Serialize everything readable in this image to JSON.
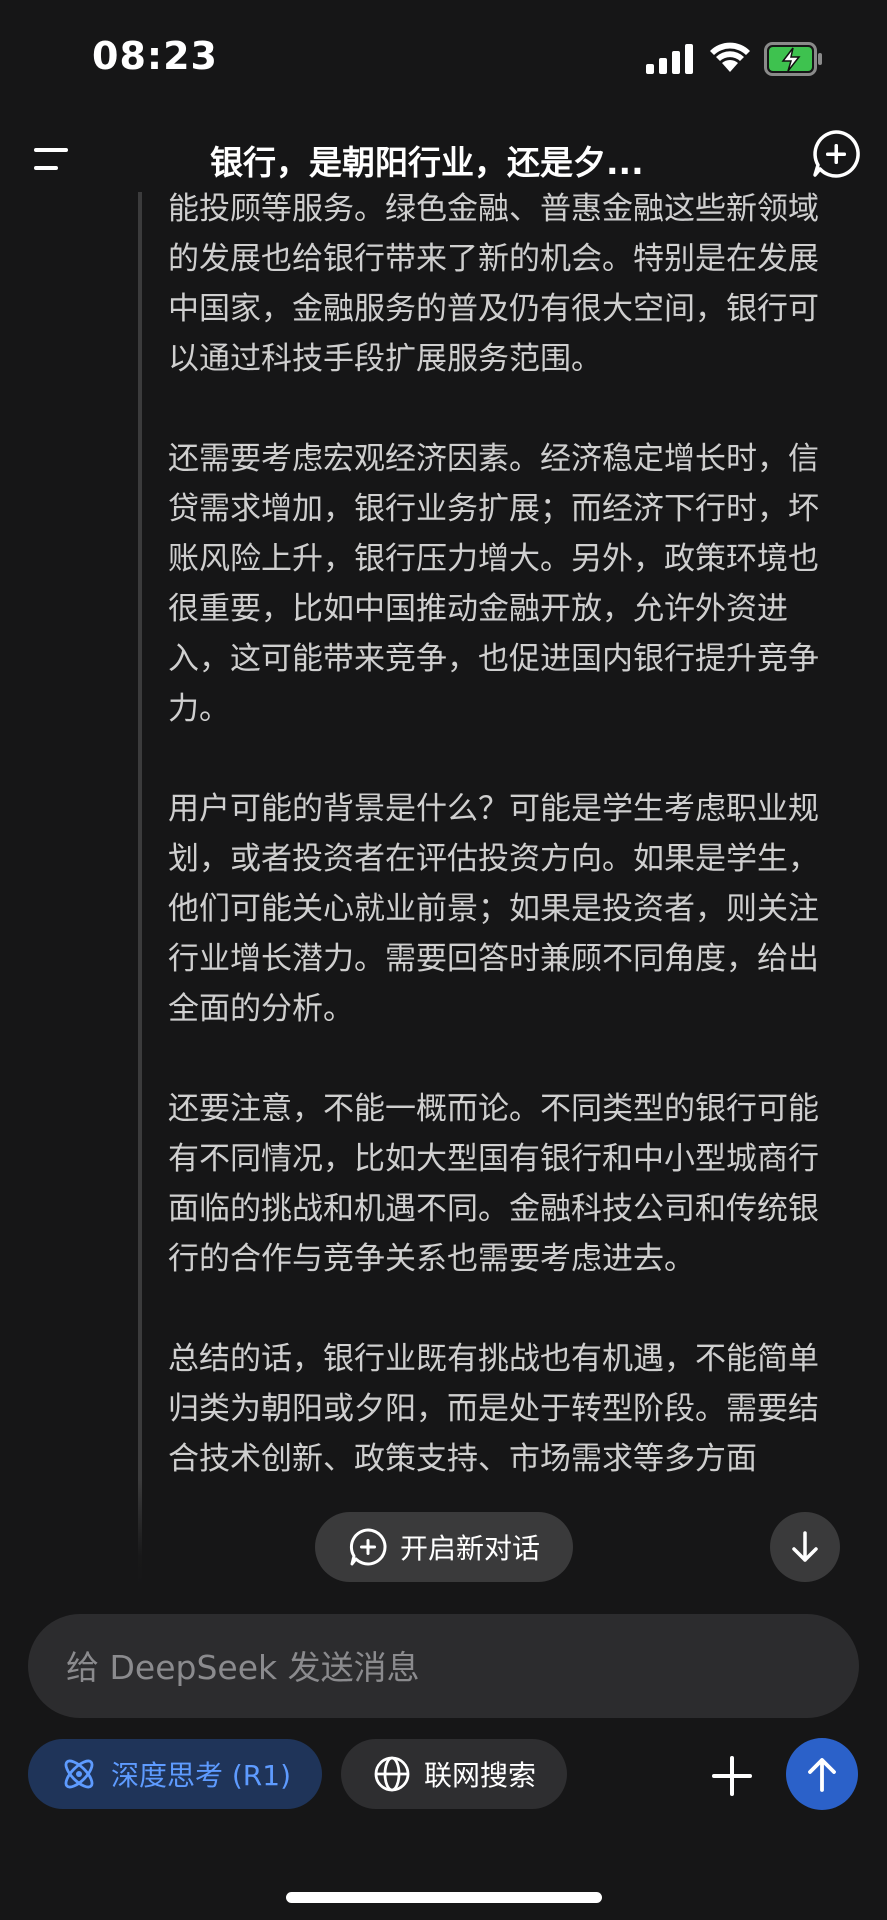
{
  "status_bar": {
    "time": "08:23"
  },
  "header": {
    "title": "银行，是朝阳行业，还是夕..."
  },
  "thinking": {
    "paragraphs": [
      "能投顾等服务。绿色金融、普惠金融这些新领域的发展也给银行带来了新的机会。特别是在发展中国家，金融服务的普及仍有很大空间，银行可以通过科技手段扩展服务范围。",
      "还需要考虑宏观经济因素。经济稳定增长时，信贷需求增加，银行业务扩展；而经济下行时，坏账风险上升，银行压力增大。另外，政策环境也很重要，比如中国推动金融开放，允许外资进入，这可能带来竞争，也促进国内银行提升竞争力。",
      "用户可能的背景是什么？可能是学生考虑职业规划，或者投资者在评估投资方向。如果是学生，他们可能关心就业前景；如果是投资者，则关注行业增长潜力。需要回答时兼顾不同角度，给出全面的分析。",
      "还要注意，不能一概而论。不同类型的银行可能有不同情况，比如大型国有银行和中小型城商行面临的挑战和机遇不同。金融科技公司和传统银行的合作与竞争关系也需要考虑进去。",
      "总结的话，银行业既有挑战也有机遇，不能简单归类为朝阳或夕阳，而是处于转型阶段。需要结合技术创新、政策支持、市场需求等多方面"
    ]
  },
  "new_chat_pill": {
    "label": "开启新对话"
  },
  "composer": {
    "placeholder": "给 DeepSeek 发送消息"
  },
  "toolbar": {
    "deep_think_label": "深度思考 (R1)",
    "web_search_label": "联网搜索"
  },
  "colors": {
    "accent": "#2b61c9",
    "deep_think_text": "#5e9bff",
    "background": "#161617"
  }
}
